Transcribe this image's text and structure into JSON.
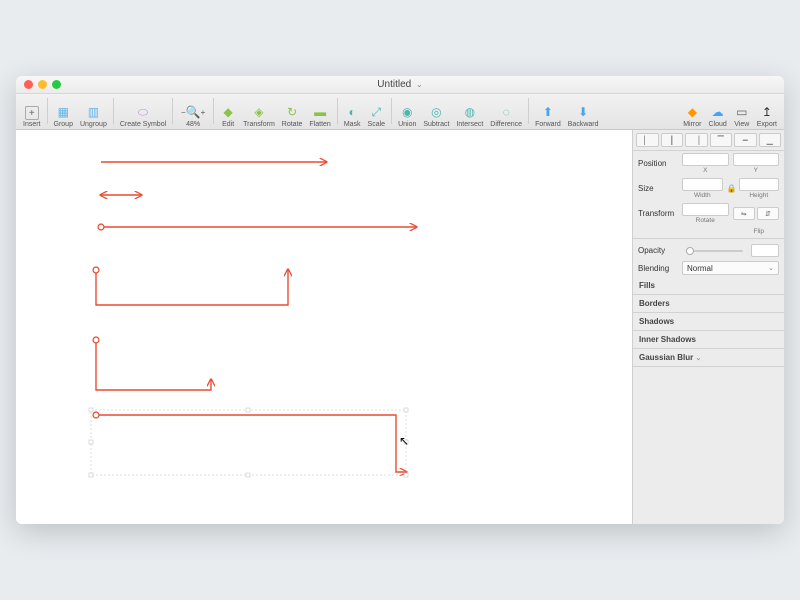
{
  "window": {
    "title": "Untitled"
  },
  "toolbar": {
    "insert": "Insert",
    "group": "Group",
    "ungroup": "Ungroup",
    "create_symbol": "Create Symbol",
    "zoom": "48%",
    "edit": "Edit",
    "transform": "Transform",
    "rotate": "Rotate",
    "flatten": "Flatten",
    "mask": "Mask",
    "scale": "Scale",
    "union": "Union",
    "subtract": "Subtract",
    "intersect": "Intersect",
    "difference": "Difference",
    "forward": "Forward",
    "backward": "Backward",
    "mirror": "Mirror",
    "cloud": "Cloud",
    "view": "View",
    "export": "Export"
  },
  "inspector": {
    "position": "Position",
    "x": "X",
    "y": "Y",
    "size": "Size",
    "width": "Width",
    "height": "Height",
    "transform": "Transform",
    "rotate_label": "Rotate",
    "flip": "Flip",
    "opacity": "Opacity",
    "blending": "Blending",
    "blending_value": "Normal",
    "fills": "Fills",
    "borders": "Borders",
    "shadows": "Shadows",
    "inner_shadows": "Inner Shadows",
    "gaussian_blur": "Gaussian Blur"
  },
  "colors": {
    "arrow": "#e84c32"
  }
}
